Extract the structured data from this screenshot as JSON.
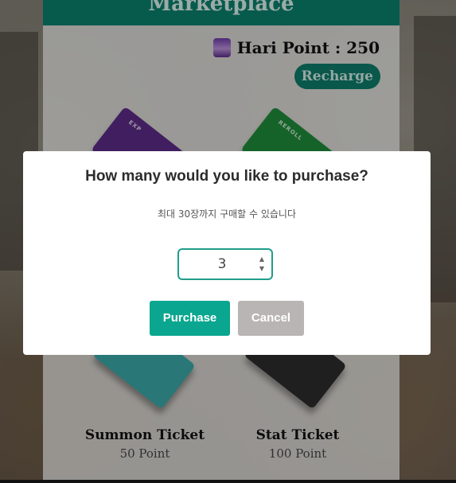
{
  "panel": {
    "header_title": "Marketplace",
    "points_label": "Hari Point : 250",
    "recharge_label": "Recharge"
  },
  "tickets": [
    {
      "label": "EXP",
      "color": "#5b2a86"
    },
    {
      "label": "REROLL",
      "color": "#1f8a3a"
    },
    {
      "name": "Summon Ticket",
      "price": "50 Point",
      "color": "#3aa6a6"
    },
    {
      "name": "Stat Ticket",
      "price": "100 Point",
      "color": "#2b2b2b"
    }
  ],
  "modal": {
    "title": "How many would you like to purchase?",
    "subtitle": "최대 30장까지 구매할 수 있습니다",
    "quantity": "3",
    "purchase_label": "Purchase",
    "cancel_label": "Cancel"
  },
  "colors": {
    "accent": "#0aa68f",
    "header": "#0b7e6b",
    "cancel": "#b9b5b5"
  }
}
